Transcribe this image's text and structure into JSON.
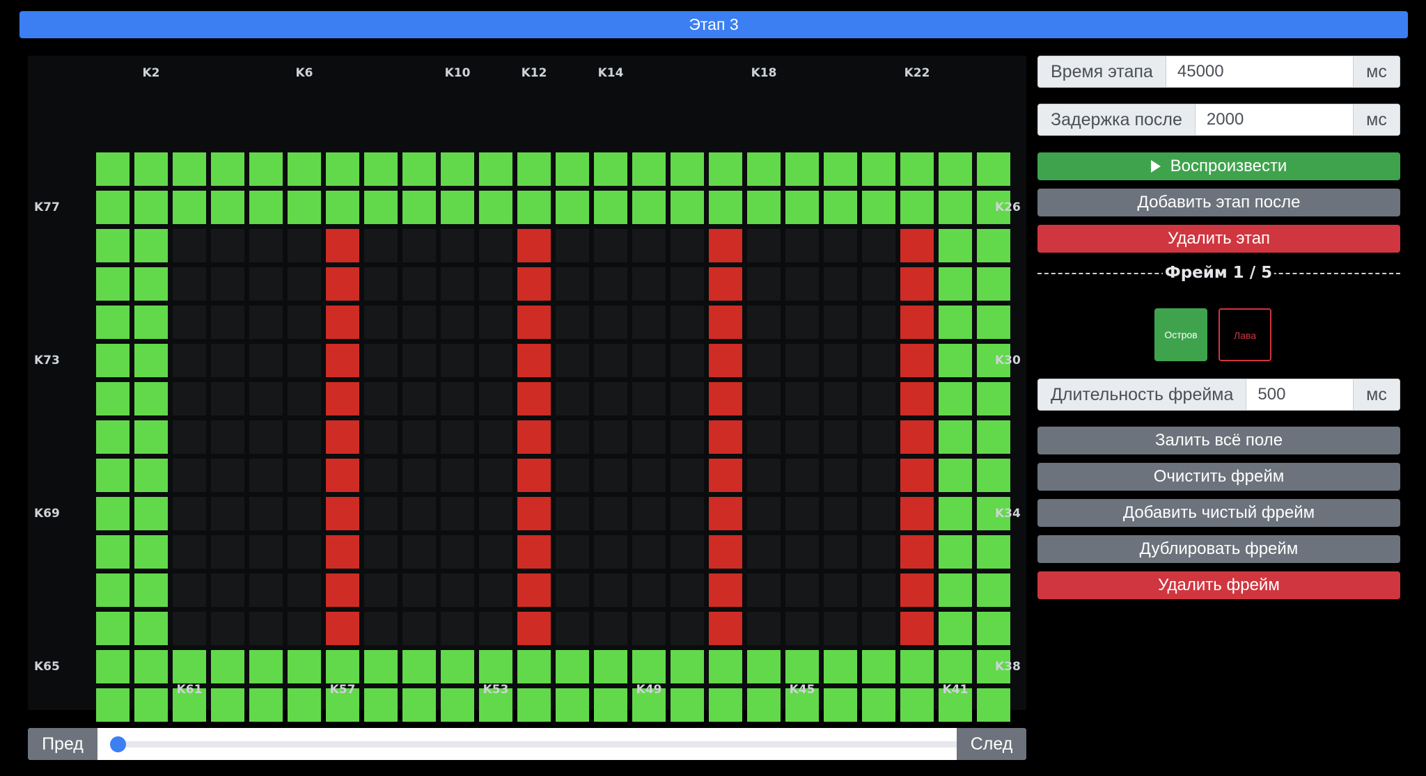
{
  "header": {
    "title": "Этап 3"
  },
  "board": {
    "columns": 24,
    "rows": 15,
    "labels_top": [
      {
        "text": "K2",
        "col": 1
      },
      {
        "text": "K6",
        "col": 5
      },
      {
        "text": "K10",
        "col": 9
      },
      {
        "text": "K12",
        "col": 11
      },
      {
        "text": "K14",
        "col": 13
      },
      {
        "text": "K18",
        "col": 17
      },
      {
        "text": "K22",
        "col": 21
      }
    ],
    "labels_bottom": [
      {
        "text": "K61",
        "col": 2
      },
      {
        "text": "K57",
        "col": 6
      },
      {
        "text": "K53",
        "col": 10
      },
      {
        "text": "K49",
        "col": 14
      },
      {
        "text": "K45",
        "col": 18
      },
      {
        "text": "K41",
        "col": 22
      }
    ],
    "labels_left": [
      {
        "text": "K77",
        "row": 1
      },
      {
        "text": "K73",
        "row": 5
      },
      {
        "text": "K69",
        "row": 9
      },
      {
        "text": "K65",
        "row": 13
      }
    ],
    "labels_right": [
      {
        "text": "K26",
        "row": 1
      },
      {
        "text": "K30",
        "row": 5
      },
      {
        "text": "K34",
        "row": 9
      },
      {
        "text": "K38",
        "row": 13
      }
    ],
    "colors": {
      "I": "#62d94a",
      "L": "#cf2c25",
      "E": "#151719"
    },
    "cells": [
      "IIIIIIIIIIIIIIIIIIIIIIII",
      "IIIIIIIIIIIIIIIIIIIIIIII",
      "IIEEEELEEEELEEEELEEEELII",
      "IIEEEELEEEELEEEELEEEELII",
      "IIEEEELEEEELEEEELEEEELII",
      "IIEEEELEEEELEEEELEEEELII",
      "IIEEEELEEEELEEEELEEEELII",
      "IIEEEELEEEELEEEELEEEELII",
      "IIEEEELEEEELEEEELEEEELII",
      "IIEEEELEEEELEEEELEEEELII",
      "IIEEEELEEEELEEEELEEEELII",
      "IIEEEELEEEELEEEELEEEELII",
      "IIEEEELEEEELEEEELEEEELII",
      "IIIIIIIIIIIIIIIIIIIIIIII",
      "IIIIIIIIIIIIIIIIIIIIIIII"
    ]
  },
  "navigation": {
    "prev_label": "Пред",
    "next_label": "След",
    "slider_position": 0
  },
  "stage": {
    "time_label": "Время этапа",
    "time_value": "45000",
    "time_unit": "мс",
    "delay_label": "Задержка после",
    "delay_value": "2000",
    "delay_unit": "мс",
    "play_label": "Воспроизвести",
    "add_stage_label": "Добавить этап после",
    "delete_stage_label": "Удалить этап"
  },
  "frame": {
    "title": "Фрейм 1 / 5",
    "swatch_island": "Остров",
    "swatch_lava": "Лава",
    "duration_label": "Длительность фрейма",
    "duration_value": "500",
    "duration_unit": "мс",
    "fill_all_label": "Залить всё поле",
    "clear_label": "Очистить фрейм",
    "add_blank_label": "Добавить чистый фрейм",
    "duplicate_label": "Дублировать фрейм",
    "delete_label": "Удалить фрейм"
  }
}
